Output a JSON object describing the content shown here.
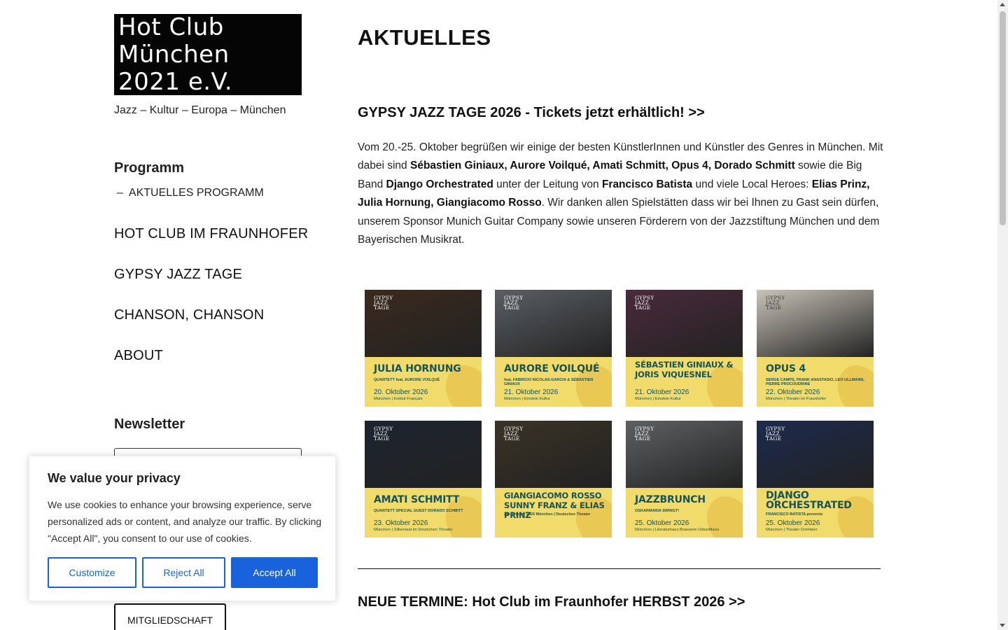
{
  "site": {
    "title": "Hot Club München 2021 e.V.",
    "tagline": "Jazz – Kultur – Europa – München"
  },
  "sidebar": {
    "program_heading": "Programm",
    "sub_item": "AKTUELLES PROGRAMM",
    "nav": [
      "HOT CLUB IM FRAUNHOFER",
      "GYPSY JAZZ TAGE",
      "CHANSON, CHANSON",
      "ABOUT"
    ],
    "newsletter_heading": "Newsletter",
    "membership_button": "MITGLIEDSCHAFT"
  },
  "main": {
    "page_title": "AKTUELLES",
    "article1": {
      "title": "GYPSY JAZZ TAGE 2026 - Tickets jetzt erhältlich! >>",
      "t1": "Vom 20.-25. Oktober begrüßen wir einige der besten KünstlerInnen und Künstler des Genres in München. Mit dabei sind ",
      "b1": "Sébastien Giniaux, Aurore Voilqué, Amati Schmitt, Opus 4, Dorado Schmitt",
      "t2": " sowie die Big Band ",
      "b2": "Django Orchestrated",
      "t3": " unter der Leitung von ",
      "b3": "Francisco Batista",
      "t4": " und viele Local Heroes: ",
      "b4": "Elias Prinz, Julia Hornung, Giangiacomo Rosso",
      "t5": ". Wir danken allen Spielstätten dass wir bei Ihnen zu Gast sein dürfen, unserem Sponsor Munich Guitar Company sowie unseren Förderern von der Jazzstiftung München und dem Bayerischen Musikrat."
    },
    "posters": [
      {
        "name": "JULIA HORNUNG",
        "sub": "QUARTETT feat. AURORE VOILQUÉ",
        "date": "20. Oktober 2026",
        "loc": "München | Institut Français",
        "photo": "#3b2a1e"
      },
      {
        "name": "AURORE VOILQUÉ",
        "sub": "feat. FABRICIO NICOLAS-GARCIA & SÉBASTIEN GINIAUX",
        "date": "21. Oktober 2026",
        "loc": "München | Einstein Kultur",
        "photo": "#5a5f64"
      },
      {
        "name": "SÉBASTIEN GINIAUX & JORIS VIQUESNEL",
        "sub": "",
        "date": "21. Oktober 2026",
        "loc": "München | Einstein Kultur",
        "photo": "#4a2a3c"
      },
      {
        "name": "OPUS 4",
        "sub": "SERGE CAMPS, FRANK ANASTASIO, LEO ULLMANN, PIERRE PROCOUDRINE",
        "date": "22. Oktober 2026",
        "loc": "München | Theater im Fraunhofer",
        "photo": "#c9c3b8"
      },
      {
        "name": "AMATI SCHMITT",
        "sub": "QUARTETT SPECIAL GUEST DORADO SCHMITT",
        "date": "23. Oktober 2026",
        "loc": "München | Silbersaal im Deutschen Theater",
        "photo": "#1d2430"
      },
      {
        "name": "GIANGIACOMO ROSSO SUNNY FRANZ & ELIAS PRINZ",
        "sub": "24. Oktober 2026 München | Deutsches Theater",
        "date": "",
        "loc": "",
        "photo": "#3a3326"
      },
      {
        "name": "JAZZBRUNCH",
        "sub": "OSKARMARIA SWINGT!",
        "date": "25. Oktober 2026",
        "loc": "München | Literaturhaus Brasserie OskarMaria",
        "photo": "#5d6062"
      },
      {
        "name": "DJANGO ORCHESTRATED",
        "sub": "FRANCISCO BATISTA presents",
        "date": "25. Oktober 2026",
        "loc": "München | Theater Drehleier",
        "photo": "#1c2a4e"
      }
    ],
    "poster_logo": "GYPSY JAZZ TAGE",
    "article2_title": "NEUE TERMINE: Hot Club im Fraunhofer HERBST 2026 >>"
  },
  "cookie": {
    "title": "We value your privacy",
    "text": "We use cookies to enhance your browsing experience, serve personalized ads or content, and analyze our traffic. By clicking \"Accept All\", you consent to our use of cookies.",
    "customize": "Customize",
    "reject": "Reject All",
    "accept": "Accept All",
    "accent_color": "#1863dc"
  }
}
